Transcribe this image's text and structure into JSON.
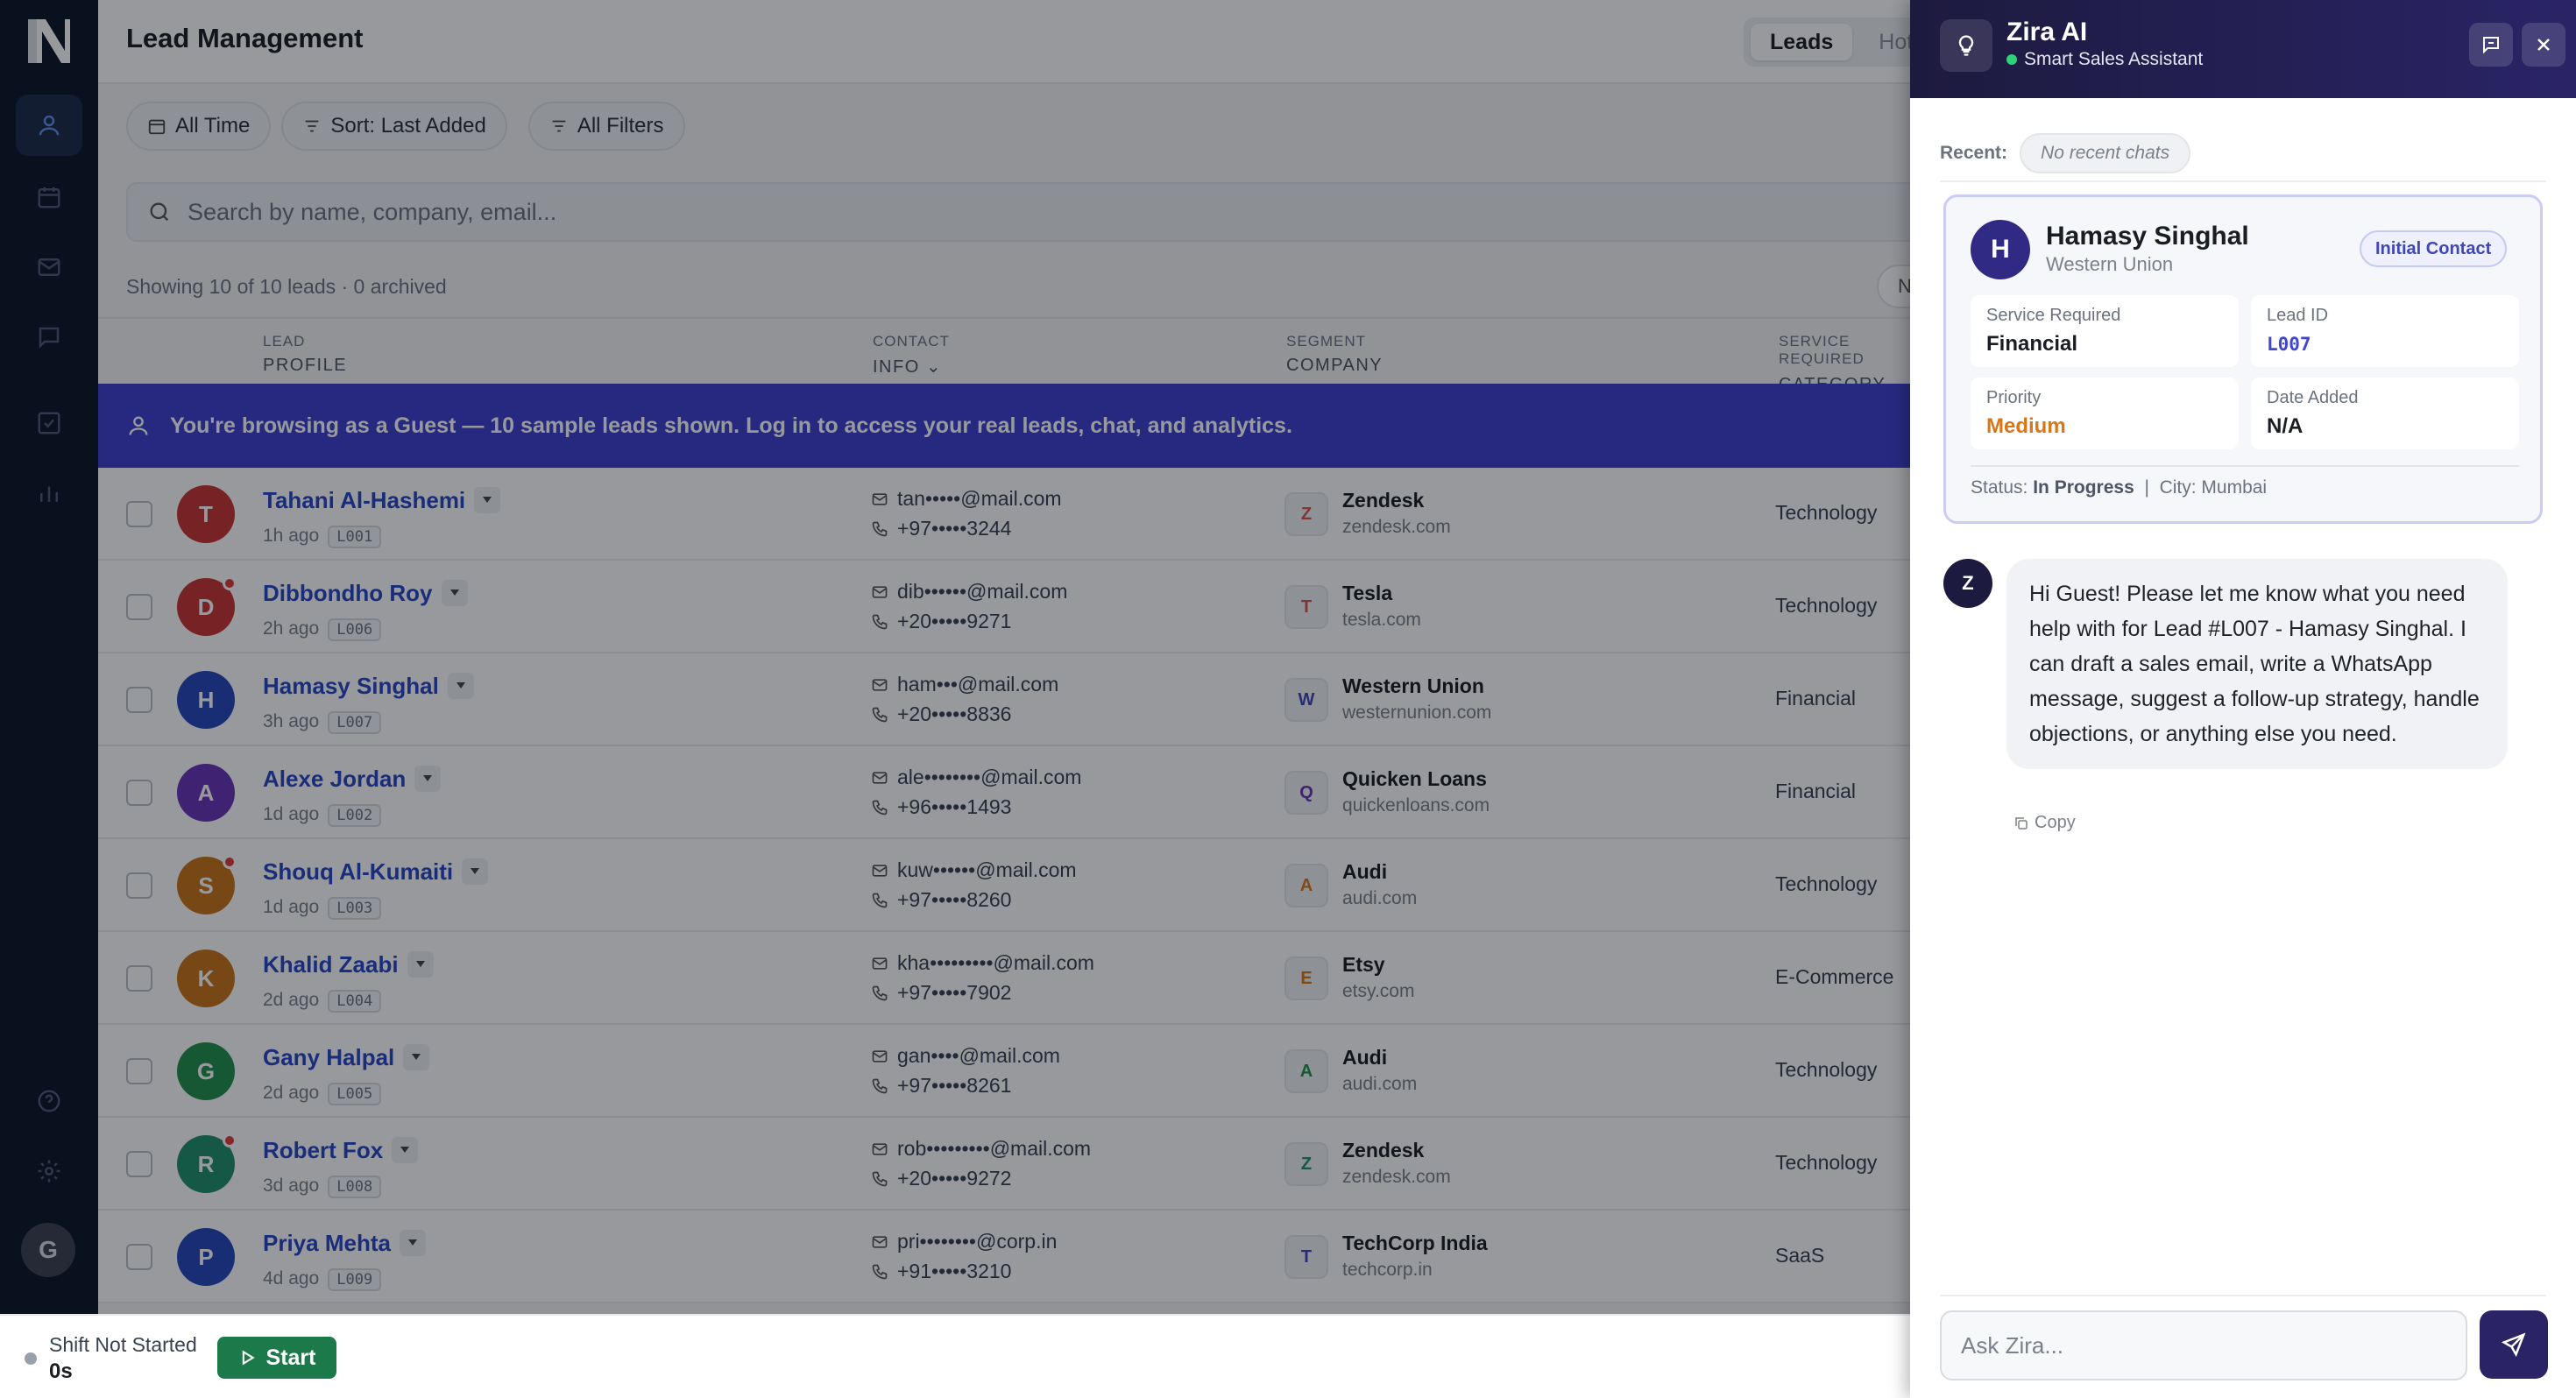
{
  "rail": {
    "avatar_initial": "G",
    "nav": [
      "leads-icon",
      "calendar-icon",
      "mail-icon",
      "chat-icon",
      "tasks-icon",
      "analytics-icon",
      "help-icon",
      "settings-icon"
    ]
  },
  "header": {
    "title": "Lead Management",
    "tabs": [
      "Leads",
      "Hot"
    ]
  },
  "filters": {
    "time": "All Time",
    "sort": "Sort: Last Added",
    "all": "All Filters"
  },
  "search": {
    "placeholder": "Search by name, company, email..."
  },
  "summary": "Showing 10 of 10 leads · 0 archived",
  "pager_label": "N",
  "columns": {
    "lead": {
      "small": "LEAD",
      "big": "PROFILE"
    },
    "contact": {
      "small": "CONTACT",
      "big": "INFO ⌄"
    },
    "segment": {
      "small": "SEGMENT",
      "big": "COMPANY"
    },
    "service": {
      "small": "SERVICE REQUIRED",
      "big": "CATEGORY ⌄"
    }
  },
  "banner": "You're browsing as a Guest — 10 sample leads shown. Log in to access your real leads, chat, and analytics.",
  "leads": [
    {
      "initial": "T",
      "color": "#c93434",
      "name": "Tahani Al-Hashemi",
      "ago": "1h ago",
      "id": "L001",
      "email": "tan•••••@mail.com",
      "phone": "+97•••••3244",
      "logo": "Z",
      "logo_color": "#d9534f",
      "company": "Zendesk",
      "domain": "zendesk.com",
      "category": "Technology",
      "dot": false
    },
    {
      "initial": "D",
      "color": "#c93434",
      "name": "Dibbondho Roy",
      "ago": "2h ago",
      "id": "L006",
      "email": "dib••••••@mail.com",
      "phone": "+20•••••9271",
      "logo": "T",
      "logo_color": "#d9534f",
      "company": "Tesla",
      "domain": "tesla.com",
      "category": "Technology",
      "dot": true
    },
    {
      "initial": "H",
      "color": "#2546b8",
      "name": "Hamasy Singhal",
      "ago": "3h ago",
      "id": "L007",
      "email": "ham•••@mail.com",
      "phone": "+20•••••8836",
      "logo": "W",
      "logo_color": "#3f46b8",
      "company": "Western Union",
      "domain": "westernunion.com",
      "category": "Financial",
      "dot": false
    },
    {
      "initial": "A",
      "color": "#6a32b8",
      "name": "Alexe Jordan",
      "ago": "1d ago",
      "id": "L002",
      "email": "ale••••••••@mail.com",
      "phone": "+96•••••1493",
      "logo": "Q",
      "logo_color": "#6a32b8",
      "company": "Quicken Loans",
      "domain": "quickenloans.com",
      "category": "Financial",
      "dot": false
    },
    {
      "initial": "S",
      "color": "#c97418",
      "name": "Shouq Al-Kumaiti",
      "ago": "1d ago",
      "id": "L003",
      "email": "kuw••••••@mail.com",
      "phone": "+97•••••8260",
      "logo": "A",
      "logo_color": "#d8771a",
      "company": "Audi",
      "domain": "audi.com",
      "category": "Technology",
      "dot": true
    },
    {
      "initial": "K",
      "color": "#c97418",
      "name": "Khalid Zaabi",
      "ago": "2d ago",
      "id": "L004",
      "email": "kha•••••••••@mail.com",
      "phone": "+97•••••7902",
      "logo": "E",
      "logo_color": "#d8771a",
      "company": "Etsy",
      "domain": "etsy.com",
      "category": "E-Commerce",
      "dot": false
    },
    {
      "initial": "G",
      "color": "#1f8f4a",
      "name": "Gany Halpal",
      "ago": "2d ago",
      "id": "L005",
      "email": "gan••••@mail.com",
      "phone": "+97•••••8261",
      "logo": "A",
      "logo_color": "#1f8f4a",
      "company": "Audi",
      "domain": "audi.com",
      "category": "Technology",
      "dot": false
    },
    {
      "initial": "R",
      "color": "#1f8f6a",
      "name": "Robert Fox",
      "ago": "3d ago",
      "id": "L008",
      "email": "rob•••••••••@mail.com",
      "phone": "+20•••••9272",
      "logo": "Z",
      "logo_color": "#1f8f6a",
      "company": "Zendesk",
      "domain": "zendesk.com",
      "category": "Technology",
      "dot": true
    },
    {
      "initial": "P",
      "color": "#2546b8",
      "name": "Priya Mehta",
      "ago": "4d ago",
      "id": "L009",
      "email": "pri••••••••@corp.in",
      "phone": "+91•••••3210",
      "logo": "T",
      "logo_color": "#3f46b8",
      "company": "TechCorp India",
      "domain": "techcorp.in",
      "category": "SaaS",
      "dot": false
    }
  ],
  "shift": {
    "label": "Shift Not Started",
    "time": "0s",
    "start": "Start"
  },
  "zira": {
    "title": "Zira AI",
    "subtitle": "Smart Sales Assistant",
    "recent_label": "Recent:",
    "recent_empty": "No recent chats",
    "lead_card": {
      "initial": "H",
      "name": "Hamasy Singhal",
      "company": "Western Union",
      "stage": "Initial Contact",
      "service_label": "Service Required",
      "service_value": "Financial",
      "id_label": "Lead ID",
      "id_value": "L007",
      "priority_label": "Priority",
      "priority_value": "Medium",
      "date_label": "Date Added",
      "date_value": "N/A",
      "status_label": "Status:",
      "status_value": "In Progress",
      "city": "City: Mumbai"
    },
    "message_avatar": "Z",
    "message": "Hi Guest! Please let me know what you need help with for Lead #L007 - Hamasy Singhal. I can draft a sales email, write a WhatsApp message, suggest a follow-up strategy, handle objections, or anything else you need.",
    "copy_label": "Copy",
    "input_placeholder": "Ask Zira..."
  },
  "colors": {
    "brand": "#2a2466",
    "banner": "#3f3fd1",
    "link": "#2846c6",
    "rail": "#0c1628",
    "start": "#1c7a4a"
  }
}
